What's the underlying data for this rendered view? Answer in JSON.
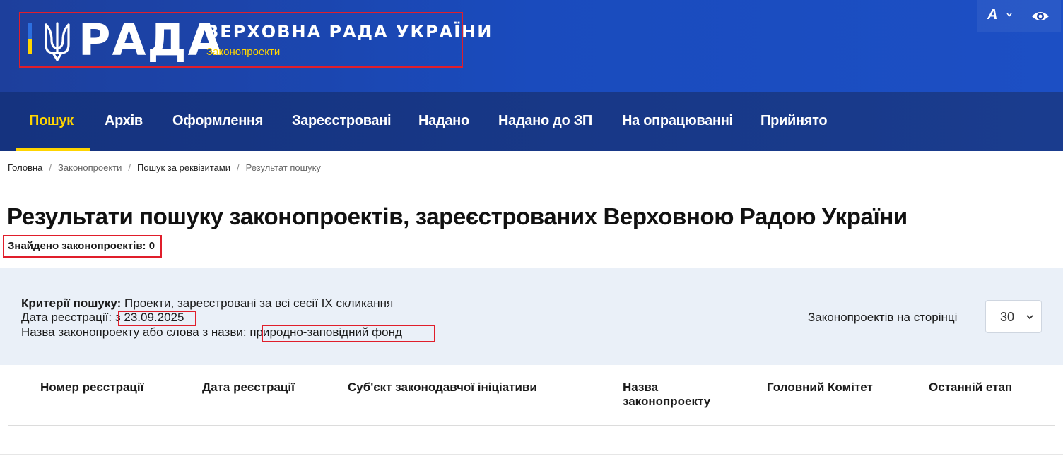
{
  "header": {
    "logo_word": "РАДА",
    "title": "ВЕРХОВНА РАДА УКРАЇНИ",
    "subtitle": "Законопроекти",
    "font_button": "A"
  },
  "nav": {
    "items": [
      {
        "label": "Пошук",
        "active": true
      },
      {
        "label": "Архів"
      },
      {
        "label": "Оформлення"
      },
      {
        "label": "Зареєстровані"
      },
      {
        "label": "Надано"
      },
      {
        "label": "Надано до ЗП"
      },
      {
        "label": "На опрацюванні"
      },
      {
        "label": "Прийнято"
      }
    ]
  },
  "breadcrumbs": [
    "Головна",
    "Законопроекти",
    "Пошук за реквізитами",
    "Результат пошуку"
  ],
  "page_title": "Результати пошуку законопроектів, зареєстрованих Верховною Радою України",
  "found": "Знайдено законопроектів: 0",
  "criteria": {
    "label": "Критерії пошуку:",
    "value": "Проекти, зареєстровані за всі сесії IX скликання",
    "date_label": "Дата реєстрації:",
    "date_value": "з 23.09.2025",
    "name_label": "Назва законопроекту або слова з назви:",
    "name_value": "природно-заповідний фонд"
  },
  "per_page": {
    "label": "Законопроектів на сторінці",
    "value": "30"
  },
  "table": {
    "columns": [
      "Номер реєстрації",
      "Дата реєстрації",
      "Суб'єкт законодавчої ініціативи",
      "Назва законопроекту",
      "Головний Комітет",
      "Останній етап"
    ]
  },
  "colors": {
    "header_blue": "#1a4bbd",
    "nav_blue": "#15337f",
    "accent_yellow": "#ffd500",
    "highlight_red": "#e01e2b"
  }
}
